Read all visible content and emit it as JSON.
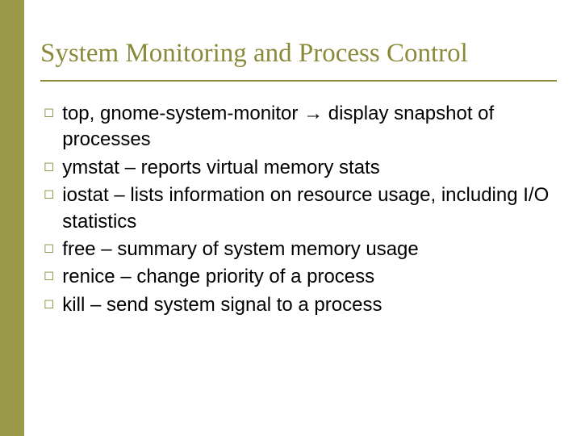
{
  "title": "System Monitoring and Process Control",
  "bullet_symbol": "◻",
  "arrow": "→",
  "items": [
    {
      "pre": "top, gnome-system-monitor ",
      "has_arrow": true,
      "post": " display snapshot of processes"
    },
    {
      "pre": "ymstat – reports virtual memory stats",
      "has_arrow": false,
      "post": ""
    },
    {
      "pre": "iostat – lists information on resource usage, including I/O statistics",
      "has_arrow": false,
      "post": ""
    },
    {
      "pre": "free – summary of system memory usage",
      "has_arrow": false,
      "post": ""
    },
    {
      "pre": "renice – change priority of a process",
      "has_arrow": false,
      "post": ""
    },
    {
      "pre": "kill – send system signal to a process",
      "has_arrow": false,
      "post": ""
    }
  ]
}
